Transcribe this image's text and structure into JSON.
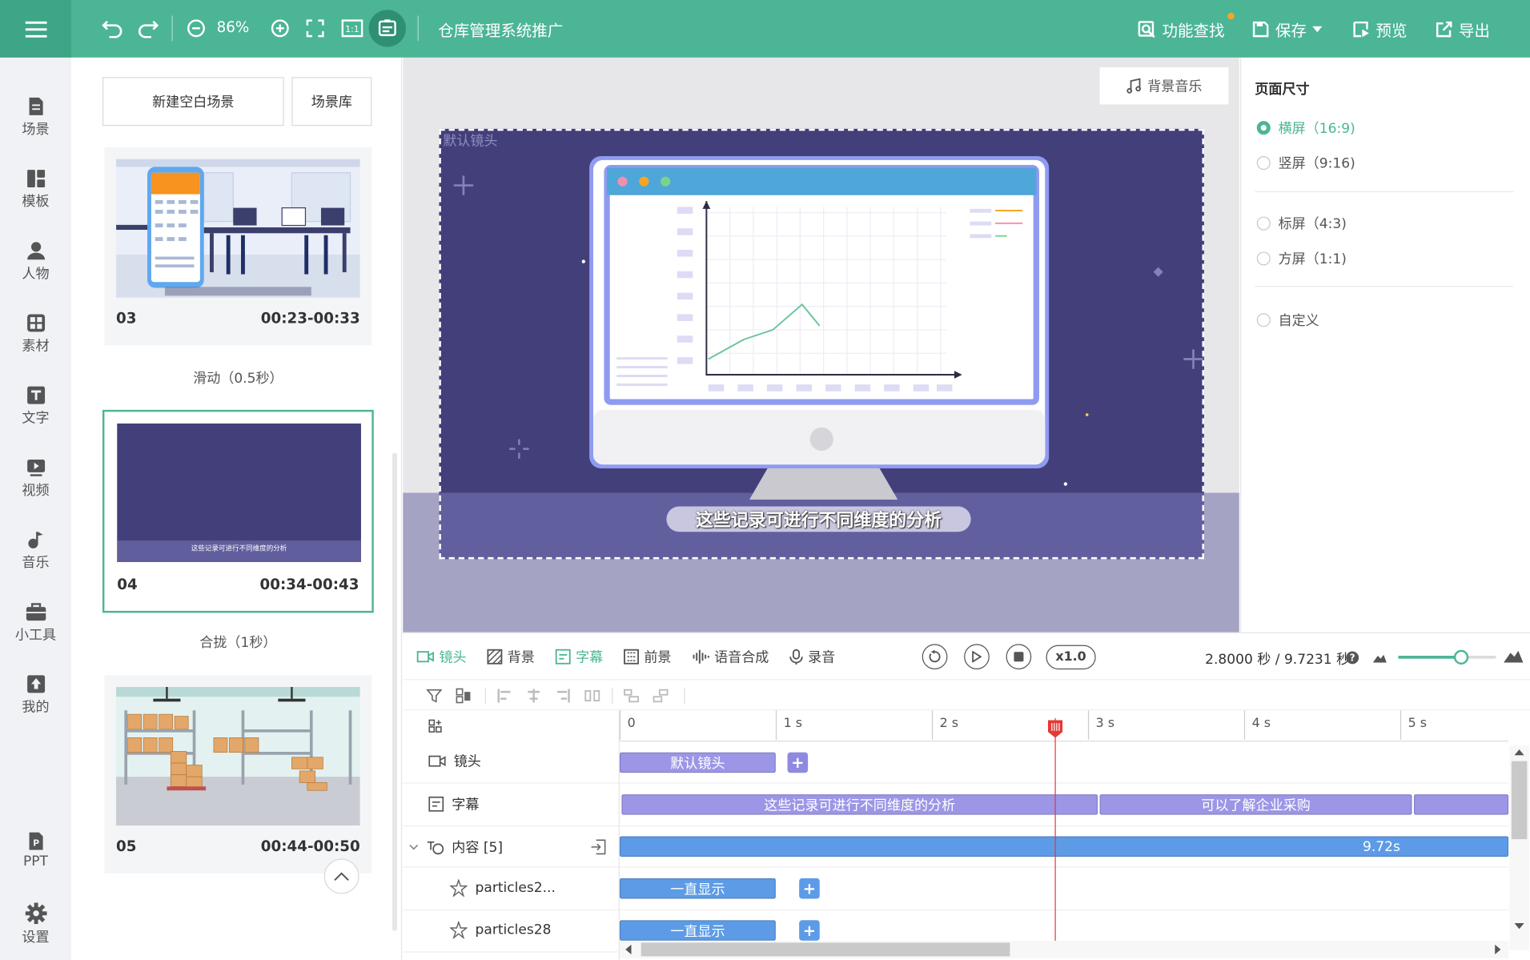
{
  "toolbar": {
    "zoom": "86%",
    "title": "仓库管理系统推广",
    "find_label": "功能查找",
    "save_label": "保存",
    "preview_label": "预览",
    "export_label": "导出"
  },
  "nav": [
    {
      "label": "场景",
      "icon": "scene-icon"
    },
    {
      "label": "模板",
      "icon": "template-icon"
    },
    {
      "label": "人物",
      "icon": "person-icon"
    },
    {
      "label": "素材",
      "icon": "material-icon"
    },
    {
      "label": "文字",
      "icon": "text-icon"
    },
    {
      "label": "视频",
      "icon": "video-icon"
    },
    {
      "label": "音乐",
      "icon": "music-icon"
    },
    {
      "label": "小工具",
      "icon": "toolbox-icon"
    },
    {
      "label": "我的",
      "icon": "upload-icon"
    },
    {
      "label": "PPT",
      "icon": "ppt-icon"
    },
    {
      "label": "设置",
      "icon": "gear-icon"
    }
  ],
  "scene_panel": {
    "new_scene": "新建空白场景",
    "library": "场景库",
    "scenes": [
      {
        "num": "03",
        "time": "00:23-00:33"
      },
      {
        "num": "04",
        "time": "00:34-00:43",
        "subtitle": "这些记录可进行不同维度的分析"
      },
      {
        "num": "05",
        "time": "00:44-00:50"
      }
    ],
    "transitions": [
      "滑动（0.5秒）",
      "合拢（1秒）"
    ]
  },
  "canvas": {
    "bg_music": "背景音乐",
    "camera_label": "默认镜头",
    "subtitle": "这些记录可进行不同维度的分析"
  },
  "props": {
    "title": "页面尺寸",
    "options": [
      "横屏（16:9)",
      "竖屏（9:16)",
      "标屏（4:3)",
      "方屏（1:1)",
      "自定义"
    ],
    "selected": 0
  },
  "timeline_tabs": [
    {
      "label": "镜头",
      "icon": "camera-icon"
    },
    {
      "label": "背景",
      "icon": "background-icon"
    },
    {
      "label": "字幕",
      "icon": "subtitle-icon"
    },
    {
      "label": "前景",
      "icon": "foreground-icon"
    },
    {
      "label": "语音合成",
      "icon": "voice-synthesis-icon"
    },
    {
      "label": "录音",
      "icon": "microphone-icon"
    }
  ],
  "playback": {
    "speed": "x1.0",
    "time": "2.8000 秒 / 9.7231 秒"
  },
  "ruler": [
    "0",
    "1 s",
    "2 s",
    "3 s",
    "4 s",
    "5 s"
  ],
  "tracks": [
    {
      "label": "镜头",
      "clips": [
        "默认镜头"
      ]
    },
    {
      "label": "字幕",
      "clips": [
        "这些记录可进行不同维度的分析",
        "可以了解企业采购"
      ]
    },
    {
      "label": "内容 [5]",
      "clips": [
        "9.72s"
      ]
    },
    {
      "label": "particles2...",
      "clips": [
        "一直显示"
      ]
    },
    {
      "label": "particles28",
      "clips": [
        "一直显示"
      ]
    }
  ],
  "colors": {
    "accent": "#4cb596",
    "clip_purple": "#9b96e6",
    "clip_blue": "#5d9be6",
    "playhead": "#e53935",
    "scene_bg": "#433f7a"
  }
}
